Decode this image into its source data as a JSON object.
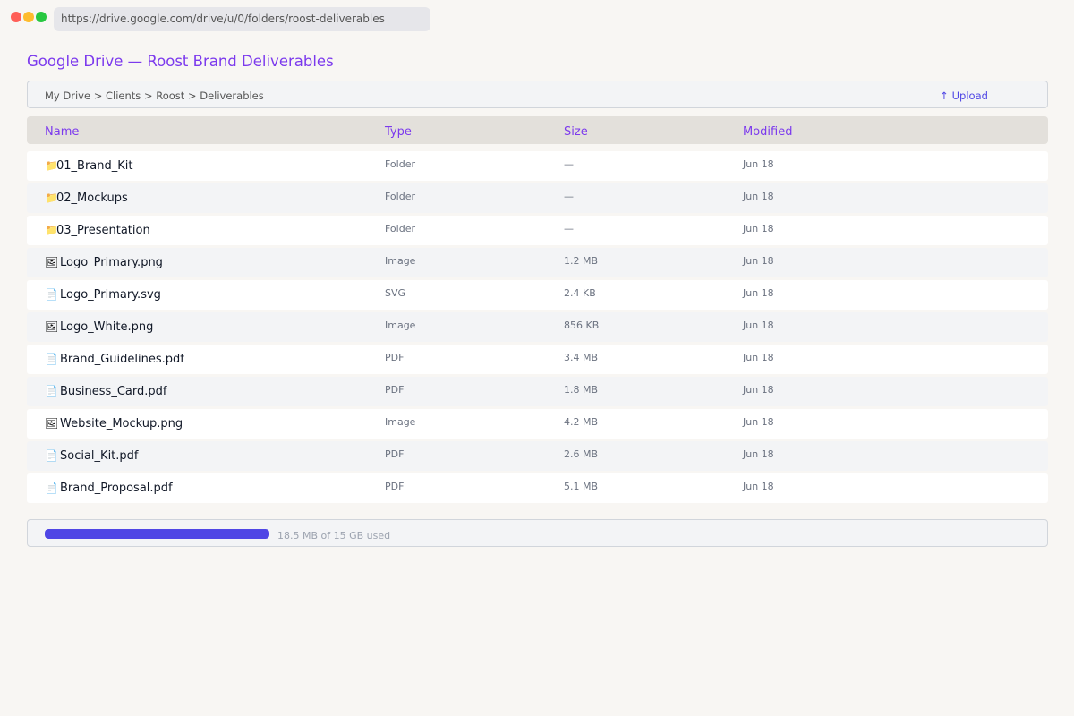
{
  "browser": {
    "url": "https://drive.google.com/drive/u/0/folders/roost-deliverables",
    "dot_colors": [
      "#ff5f57",
      "#febc2e",
      "#28c840"
    ]
  },
  "page": {
    "title": "Google Drive — Roost Brand Deliverables"
  },
  "toolbar": {
    "breadcrumb": "My Drive > Clients > Roost > Deliverables",
    "upload_arrow": "↑",
    "upload_label": "Upload"
  },
  "table": {
    "headers": {
      "name": "Name",
      "type": "Type",
      "size": "Size",
      "modified": "Modified"
    },
    "rows": [
      {
        "icon": "folder-icon",
        "name": "01_Brand_Kit",
        "type": "Folder",
        "size": "—",
        "modified": "Jun 18"
      },
      {
        "icon": "folder-icon",
        "name": "02_Mockups",
        "type": "Folder",
        "size": "—",
        "modified": "Jun 18"
      },
      {
        "icon": "folder-icon",
        "name": "03_Presentation",
        "type": "Folder",
        "size": "—",
        "modified": "Jun 18"
      },
      {
        "icon": "image-file-icon",
        "name": "Logo_Primary.png",
        "type": "Image",
        "size": "1.2 MB",
        "modified": "Jun 18"
      },
      {
        "icon": "svg-file-icon",
        "name": "Logo_Primary.svg",
        "type": "SVG",
        "size": "2.4 KB",
        "modified": "Jun 18"
      },
      {
        "icon": "image-file-icon",
        "name": "Logo_White.png",
        "type": "Image",
        "size": "856 KB",
        "modified": "Jun 18"
      },
      {
        "icon": "pdf-file-icon",
        "name": "Brand_Guidelines.pdf",
        "type": "PDF",
        "size": "3.4 MB",
        "modified": "Jun 18"
      },
      {
        "icon": "pdf-file-icon",
        "name": "Business_Card.pdf",
        "type": "PDF",
        "size": "1.8 MB",
        "modified": "Jun 18"
      },
      {
        "icon": "image-file-icon",
        "name": "Website_Mockup.png",
        "type": "Image",
        "size": "4.2 MB",
        "modified": "Jun 18"
      },
      {
        "icon": "pdf-file-icon",
        "name": "Social_Kit.pdf",
        "type": "PDF",
        "size": "2.6 MB",
        "modified": "Jun 18"
      },
      {
        "icon": "pdf-file-icon",
        "name": "Brand_Proposal.pdf",
        "type": "PDF",
        "size": "5.1 MB",
        "modified": "Jun 18"
      }
    ]
  },
  "storage": {
    "used_fraction": 1.0,
    "label": "18.5 MB of 15 GB used",
    "bar_color": "#4f46e5"
  },
  "colors": {
    "accent": "#7c3aed",
    "link": "#4f46e5"
  }
}
